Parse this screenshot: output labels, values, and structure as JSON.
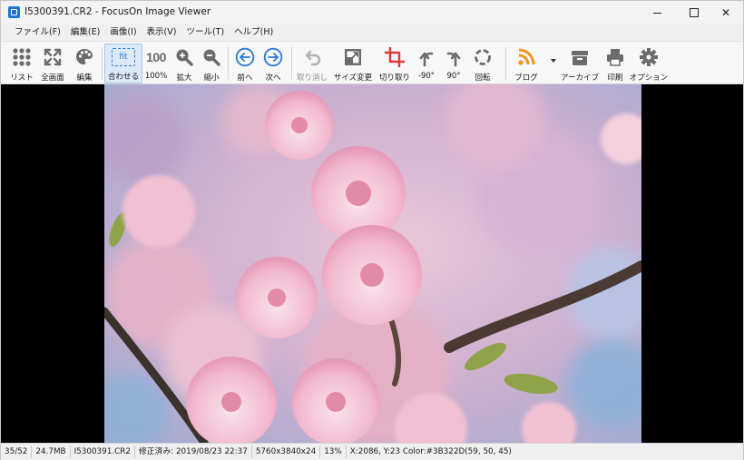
{
  "window": {
    "title": "I5300391.CR2 - FocusOn Image Viewer",
    "controls": {
      "minimize": "",
      "maximize": "",
      "close": "✕"
    }
  },
  "menu": [
    {
      "label": "ファイル(F)"
    },
    {
      "label": "編集(E)"
    },
    {
      "label": "画像(I)"
    },
    {
      "label": "表示(V)"
    },
    {
      "label": "ツール(T)"
    },
    {
      "label": "ヘルプ(H)"
    }
  ],
  "toolbar": {
    "list": "リスト",
    "fullscreen": "全画面",
    "edit": "編集",
    "fit_icon": "fit",
    "fit": "合わせる",
    "zoom100_icon": "100",
    "zoom100": "100%",
    "zoom_in": "拡大",
    "zoom_out": "縮小",
    "prev": "前へ",
    "next": "次へ",
    "undo": "取り消し",
    "resize": "サイズ変更",
    "crop": "切り取り",
    "rotate_left": "-90°",
    "rotate_right": "90°",
    "rotate": "回転",
    "blog": "ブログ",
    "archive": "アーカイブ",
    "print": "印刷",
    "options": "オプション"
  },
  "status": {
    "position": "35/52",
    "filesize": "24.7MB",
    "filename": "I5300391.CR2",
    "modified": "修正済み: 2019/08/23 22:37",
    "dimensions": "5760x3840x24",
    "zoom": "13%",
    "pixel": "X:2086, Y:23 Color:#3B322D(59, 50, 45)"
  },
  "colors": {
    "accent": "#1e73d8",
    "active_tool_bg": "#dce9f7",
    "crop_icon": "#e23a3a",
    "blog_icon": "#f7931e",
    "nav_icon": "#2b7ad6"
  }
}
